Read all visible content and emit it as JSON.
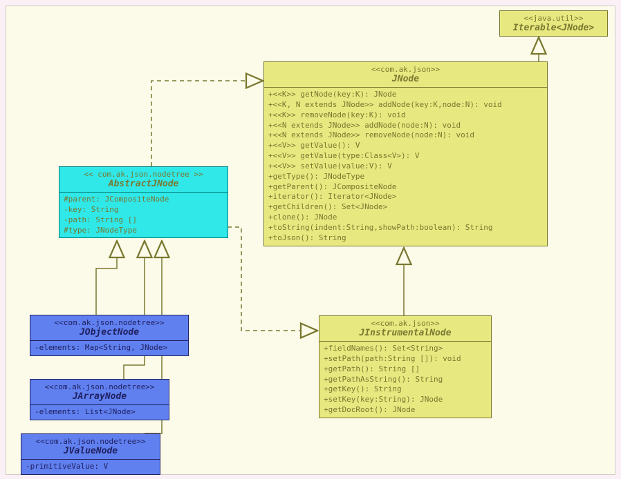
{
  "classes": {
    "iterable": {
      "stereotype": "<<java.util>>",
      "name": "Iterable<JNode>"
    },
    "jnode": {
      "stereotype": "<<com.ak.json>>",
      "name": "JNode",
      "methods": [
        "+<<K>> getNode(key:K): JNode",
        "+<<K, N extends JNode>> addNode(key:K,node:N): void",
        "+<<K>> removeNode(key:K): void",
        "+<<N extends JNode>> addNode(node:N): void",
        "+<<N extends JNode>> removeNode(node:N): void",
        "+<<V>> getValue(): V",
        "+<<V>> getValue(type:Class<V>): V",
        "+<<V>> setValue(value:V): V",
        "+getType(): JNodeType",
        "+getParent(): JCompositeNode",
        "+iterator(): Iterator<JNode>",
        "+getChildren(): Set<JNode>",
        "+clone(): JNode",
        "+toString(indent:String,showPath:boolean): String",
        "+toJson(): String"
      ]
    },
    "abstractjnode": {
      "stereotype": "<<  com.ak.json.nodetree  >>",
      "name": "AbstractJNode",
      "attrs": [
        "#parent: JCompositeNode",
        "-key: String",
        "-path: String []",
        "#type: JNodeType"
      ]
    },
    "jinstrumentalnode": {
      "stereotype": "<<com.ak.json>>",
      "name": "JInstrumentalNode",
      "methods": [
        "+fieldNames(): Set<String>",
        "+setPath(path:String []): void",
        "+getPath(): String []",
        "+getPathAsString(): String",
        "+getKey(): String",
        "+setKey(key:String): JNode",
        "+getDocRoot(): JNode"
      ]
    },
    "jobjectnode": {
      "stereotype": "<<com.ak.json.nodetree>>",
      "name": "JObjectNode",
      "attrs": [
        "-elements: Map<String, JNode>"
      ]
    },
    "jarraynode": {
      "stereotype": "<<com.ak.json.nodetree>>",
      "name": "JArrayNode",
      "attrs": [
        "-elements: List<JNode>"
      ]
    },
    "jvaluenode": {
      "stereotype": "<<com.ak.json.nodetree>>",
      "name": "JValueNode",
      "attrs": [
        "-primitiveValue: V"
      ]
    }
  }
}
